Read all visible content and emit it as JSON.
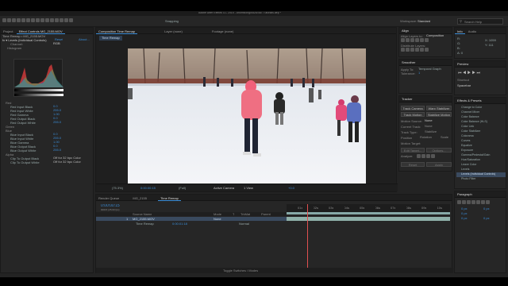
{
  "app": {
    "title": "Adobe After Effects CC 2015 - Ahomicongo\\AAE\\AE Tutorials.aep *",
    "toolbar": {
      "snapping": "Snapping",
      "workspace_label": "Workspace:",
      "workspace_value": "Standard",
      "search_placeholder": "Search Help"
    }
  },
  "left_panel": {
    "tabs": [
      "Project",
      "Effect Controls MG_2155.MOV"
    ],
    "breadcrumb": "Time Remap • MG_2155.MOV",
    "effect_name": "Levels (Individual Controls)",
    "reset": "Reset",
    "about": "About...",
    "channel_label": "Channel:",
    "channel_value": "RGB",
    "histogram_label": "Histogram",
    "sections": [
      {
        "name": "Red",
        "rows": [
          {
            "label": "Red Input Black",
            "value": "0.0"
          },
          {
            "label": "Red Input White",
            "value": "255.0"
          },
          {
            "label": "Red Gamma",
            "value": "1.00"
          },
          {
            "label": "Red Output Black",
            "value": "0.0"
          },
          {
            "label": "Red Output White",
            "value": "255.0"
          }
        ]
      },
      {
        "name": "Green",
        "rows": []
      },
      {
        "name": "Blue",
        "rows": [
          {
            "label": "Blue Input Black",
            "value": "0.0"
          },
          {
            "label": "Blue Input White",
            "value": "255.0"
          },
          {
            "label": "Blue Gamma",
            "value": "1.00"
          },
          {
            "label": "Blue Output Black",
            "value": "0.0"
          },
          {
            "label": "Blue Output White",
            "value": "255.0"
          }
        ]
      },
      {
        "name": "Alpha",
        "rows": [
          {
            "label": "Clip To Output Black",
            "value": "Off for 32 bpc Color"
          },
          {
            "label": "Clip To Output White",
            "value": "Off for 32 bpc Color"
          }
        ]
      }
    ]
  },
  "viewer": {
    "tabs": [
      "Composition Time Remap",
      "Layer (none)",
      "Footage (none)"
    ],
    "comp_tab": "Time Remap",
    "bottom_bar": {
      "zoom": "(75.3%)",
      "timecode": "0:00:00:15",
      "quality": "(Full)",
      "camera": "Active Camera",
      "views": "1 View",
      "exposure": "+0.0"
    }
  },
  "align_panel": {
    "title": "Align",
    "align_layers_to": "Align Layers to:",
    "align_target": "Composition",
    "distribute_label": "Distribute Layers:"
  },
  "smoother_panel": {
    "title": "Smoother",
    "apply_to": "Apply To:",
    "apply_value": "Temporal Graph",
    "tolerance": "Tolerance:",
    "tolerance_value": "1"
  },
  "tracker_panel": {
    "title": "Tracker",
    "buttons": [
      "Track Camera",
      "Warp Stabilizer",
      "Track Motion",
      "Stabilize Motion"
    ],
    "motion_source": "Motion Source:",
    "motion_source_value": "None",
    "current_track": "Current Track:",
    "current_track_value": "None",
    "track_type": "Track Type:",
    "track_type_value": "Stabilize",
    "checks": [
      "Position",
      "Rotation",
      "Scale"
    ],
    "motion_target": "Motion Target:",
    "edit_target": "Edit Target...",
    "options": "Options...",
    "analyze": "Analyze:",
    "reset": "Reset",
    "apply": "Apply"
  },
  "info_panel": {
    "tabs": [
      "Info",
      "Audio"
    ],
    "values": [
      "R:",
      "G:",
      "B:",
      "A: 0"
    ],
    "coords": [
      "X: 1059",
      "Y: 111"
    ]
  },
  "preview_panel": {
    "title": "Preview",
    "shortcut_label": "Shortcut",
    "shortcut_value": "Spacebar"
  },
  "effects_panel": {
    "title": "Effects & Presets",
    "items": [
      "Change to Color",
      "Channel Mixer",
      "Color Balance",
      "Color Balance (HLS)",
      "Color Link",
      "Color Stabilizer",
      "Colorama",
      "Curves",
      "Equalize",
      "Exposure",
      "Gamma/Pedestal/Gain",
      "Hue/Saturation",
      "Leave Color",
      "Levels",
      "Levels (Individual Controls)",
      "Photo Filter"
    ],
    "selected": "Levels (Individual Controls)"
  },
  "paragraph_panel": {
    "title": "Paragraph",
    "fields": [
      "0 px",
      "0 px",
      "0 px",
      "0 px",
      "0 px"
    ]
  },
  "timeline": {
    "tabs": [
      "Render Queue",
      "MG_2155",
      "Time Remap"
    ],
    "timecode": "0:00:00:15",
    "fps_note": "00015 (25.00 fps)",
    "columns": [
      "Source Name",
      "Mode",
      "T",
      "TrkMat",
      "Parent"
    ],
    "layers": [
      {
        "num": "1",
        "name": "MG_2155.MOV",
        "mode": "",
        "parent": "None",
        "selected": true
      },
      {
        "num": "",
        "name": "Time Remap",
        "value": "0:00:01:18",
        "mode": "Normal",
        "parent": "",
        "selected": false
      }
    ],
    "ruler_labels": [
      "01s",
      "02s",
      "03s",
      "04s",
      "05s",
      "06s",
      "07s",
      "08s",
      "09s",
      "10s"
    ],
    "toggle_label": "Toggle Switches / Modes"
  },
  "colors": {
    "accent": "#3a8cd6",
    "playhead": "#e05050",
    "bg": "#232323",
    "work_area": "#87a9a8"
  }
}
